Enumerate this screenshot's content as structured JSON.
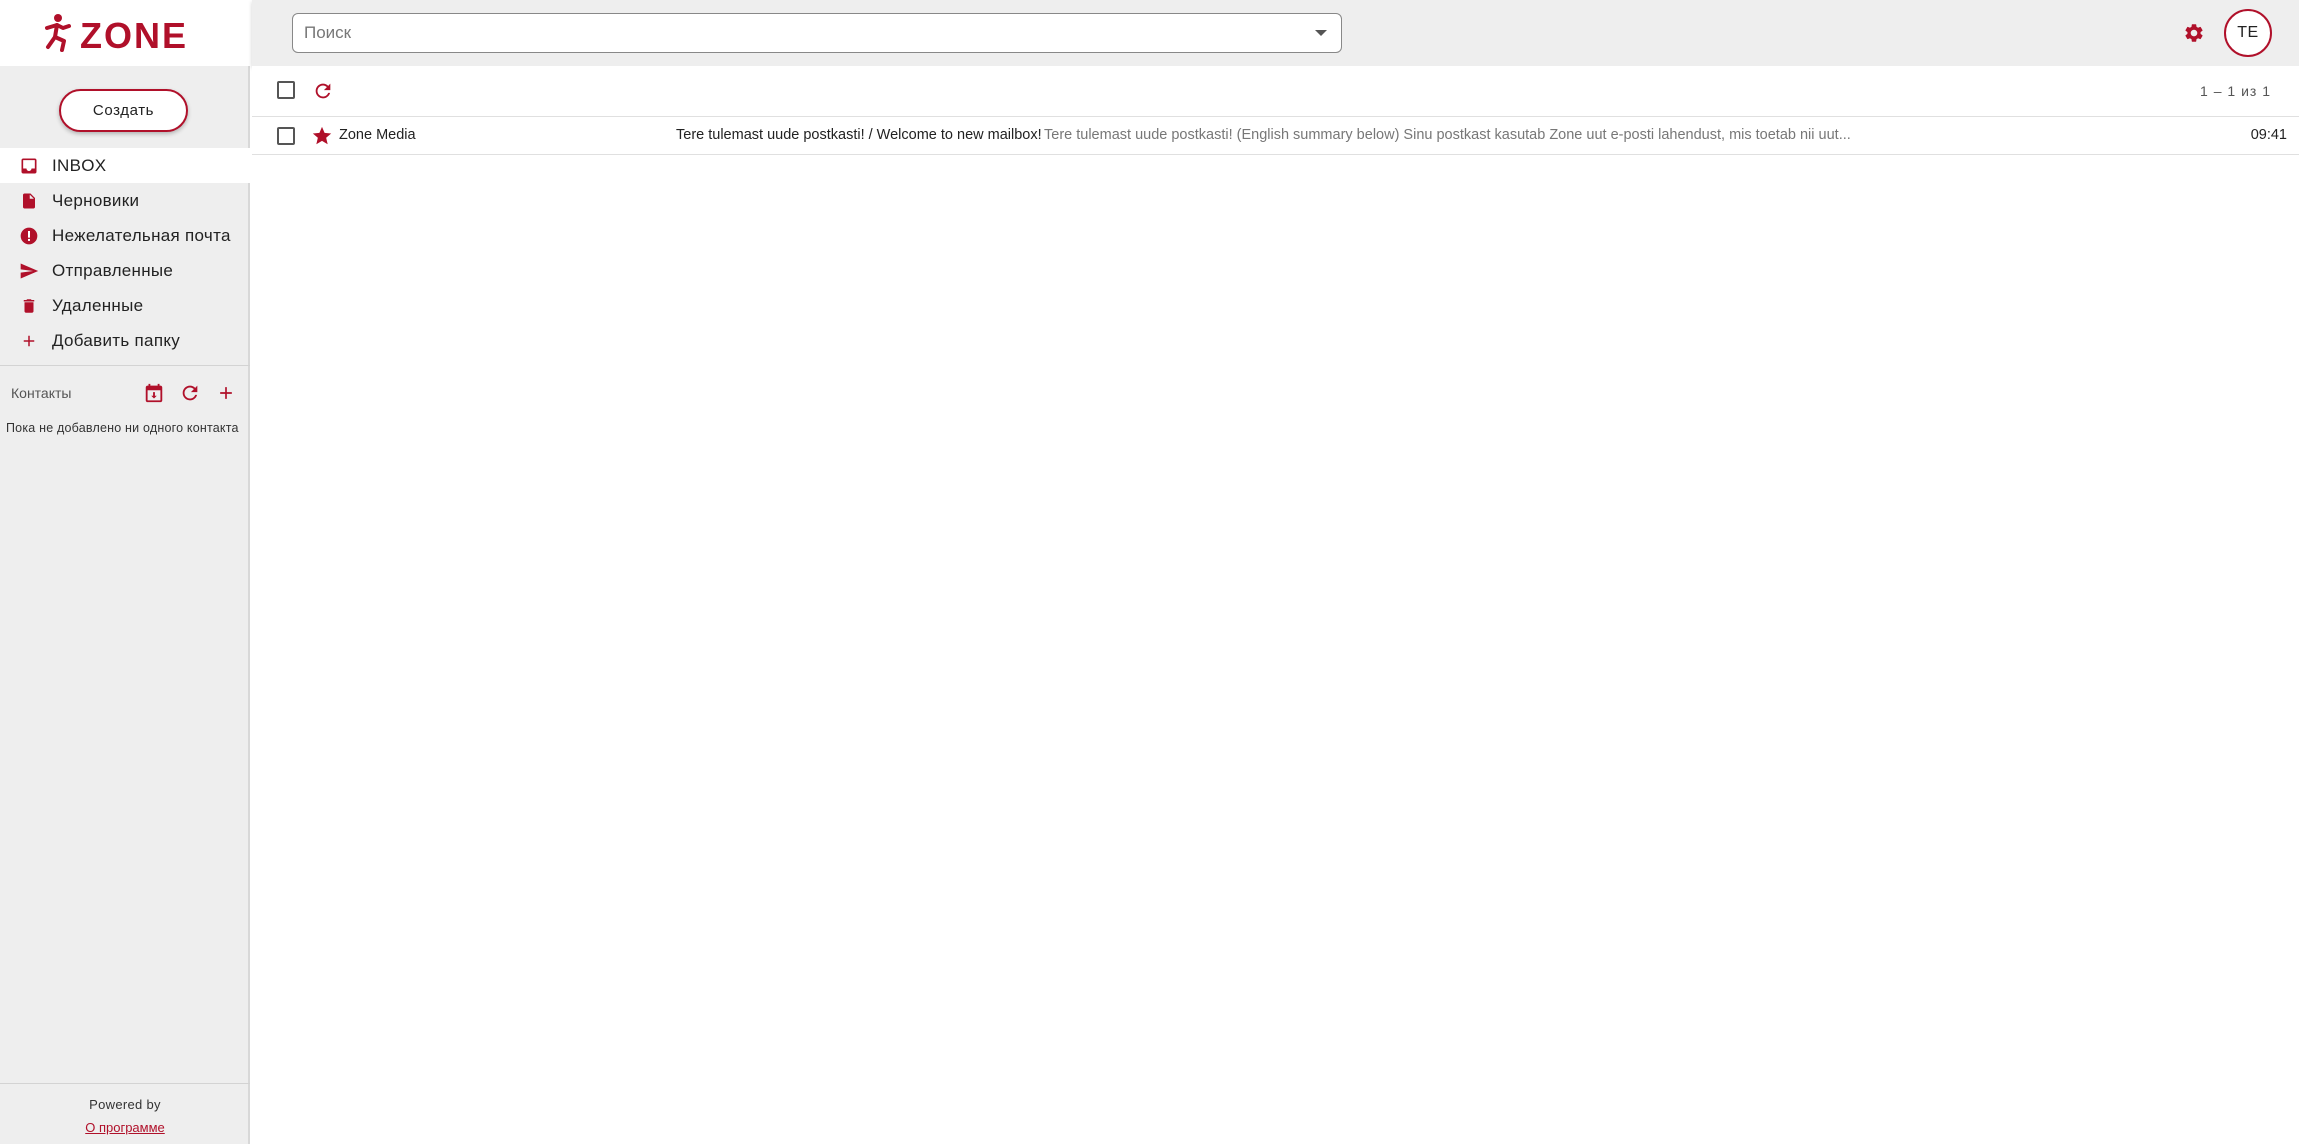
{
  "brand": {
    "logo_text": "ZONE",
    "accent_color": "#b0102a"
  },
  "sidebar": {
    "create_label": "Создать",
    "folders": [
      {
        "label": "INBOX",
        "icon": "inbox-icon",
        "active": true
      },
      {
        "label": "Черновики",
        "icon": "draft-icon",
        "active": false
      },
      {
        "label": "Нежелательная почта",
        "icon": "spam-icon",
        "active": false
      },
      {
        "label": "Отправленные",
        "icon": "send-icon",
        "active": false
      },
      {
        "label": "Удаленные",
        "icon": "trash-icon",
        "active": false
      },
      {
        "label": "Добавить папку",
        "icon": "plus-icon",
        "active": false
      }
    ],
    "contacts": {
      "title": "Контакты",
      "empty_text": "Пока не добавлено ни одного контакта"
    },
    "footer": {
      "powered_by": "Powered by",
      "about_link": "О программе"
    }
  },
  "header": {
    "search_placeholder": "Поиск",
    "search_value": "",
    "avatar_initials": "TE"
  },
  "list": {
    "count_label": "1 – 1 из 1",
    "messages": [
      {
        "sender": "Zone Media",
        "subject": "Tere tulemast uude postkasti! / Welcome to new mailbox!",
        "snippet": "Tere tulemast uude postkasti! (English summary below) Sinu postkast kasutab Zone uut e-posti lahendust, mis toetab nii uut...",
        "time": "09:41",
        "starred": true
      }
    ]
  }
}
